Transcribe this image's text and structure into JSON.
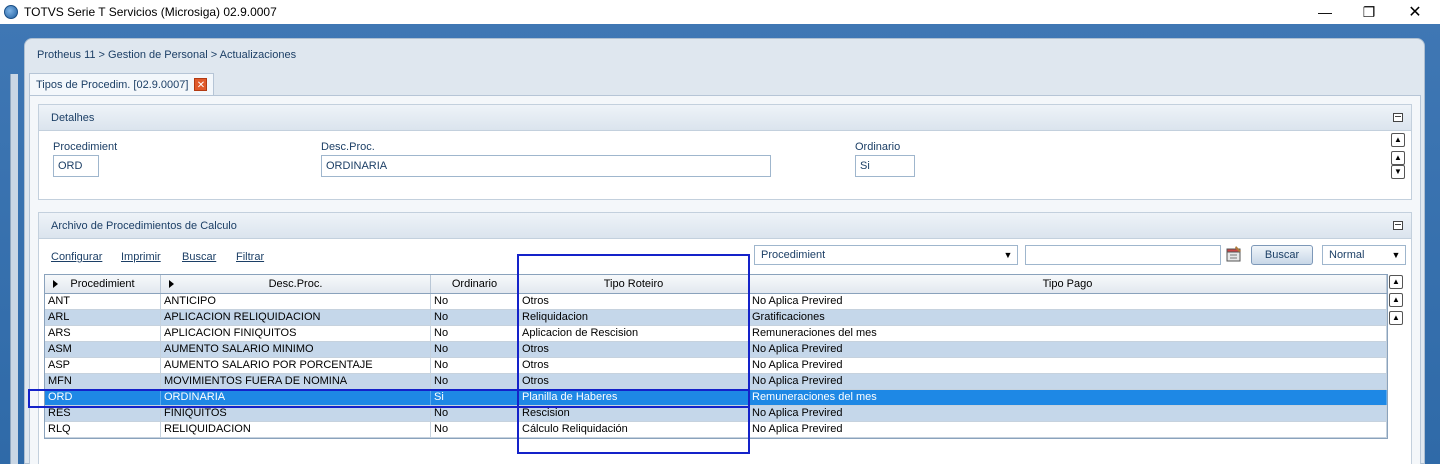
{
  "window": {
    "title": "TOTVS Serie T Servicios (Microsiga) 02.9.0007",
    "min_glyph": "—",
    "max_glyph": "❐",
    "close_glyph": "✕"
  },
  "breadcrumb": "Protheus 11 > Gestion de Personal > Actualizaciones",
  "tab": {
    "label": "Tipos de Procedim. [02.9.0007]",
    "close_glyph": "✕"
  },
  "detalhes": {
    "title": "Detalhes",
    "fields": {
      "procedimient_label": "Procedimient",
      "procedimient_value": "ORD",
      "desc_label": "Desc.Proc.",
      "desc_value": "ORDINARIA",
      "ordinario_label": "Ordinario",
      "ordinario_value": "Si"
    }
  },
  "archivo": {
    "title": "Archivo de Procedimientos de Calculo",
    "toolbar": {
      "configurar": "Configurar",
      "imprimir": "Imprimir",
      "buscar_link": "Buscar",
      "filtrar": "Filtrar",
      "search_field_select": "Procedimient",
      "search_value": "",
      "buscar_button": "Buscar",
      "mode_select": "Normal"
    },
    "columns": [
      "Procedimient",
      "Desc.Proc.",
      "Ordinario",
      "Tipo Roteiro",
      "Tipo Pago"
    ],
    "rows": [
      {
        "proc": "ANT",
        "desc": "ANTICIPO",
        "ord": "No",
        "tipo_roteiro": "Otros",
        "tipo_pago": "No Aplica Previred"
      },
      {
        "proc": "ARL",
        "desc": "APLICACION RELIQUIDACION",
        "ord": "No",
        "tipo_roteiro": "Reliquidacion",
        "tipo_pago": " Gratificaciones"
      },
      {
        "proc": "ARS",
        "desc": "APLICACION FINIQUITOS",
        "ord": "No",
        "tipo_roteiro": "Aplicacion de Rescision",
        "tipo_pago": "Remuneraciones del mes"
      },
      {
        "proc": "ASM",
        "desc": "AUMENTO SALARIO MINIMO",
        "ord": "No",
        "tipo_roteiro": "Otros",
        "tipo_pago": "No Aplica Previred"
      },
      {
        "proc": "ASP",
        "desc": "AUMENTO SALARIO POR PORCENTAJE",
        "ord": "No",
        "tipo_roteiro": "Otros",
        "tipo_pago": "No Aplica Previred"
      },
      {
        "proc": "MFN",
        "desc": "MOVIMIENTOS FUERA DE NOMINA",
        "ord": "No",
        "tipo_roteiro": "Otros",
        "tipo_pago": "No Aplica Previred"
      },
      {
        "proc": "ORD",
        "desc": "ORDINARIA",
        "ord": "Si",
        "tipo_roteiro": "Planilla de Haberes",
        "tipo_pago": "Remuneraciones del mes"
      },
      {
        "proc": "RES",
        "desc": "FINIQUITOS",
        "ord": "No",
        "tipo_roteiro": "Rescision",
        "tipo_pago": "No Aplica Previred"
      },
      {
        "proc": "RLQ",
        "desc": "RELIQUIDACION",
        "ord": "No",
        "tipo_roteiro": "Cálculo Reliquidación",
        "tipo_pago": "No Aplica Previred"
      }
    ],
    "selected_row_index": 6
  },
  "colors": {
    "desktop_blue": "#3f77b4",
    "selected_row": "#1e88e5",
    "alt_row": "#c5d7ea",
    "highlight_box": "#1422c9"
  }
}
